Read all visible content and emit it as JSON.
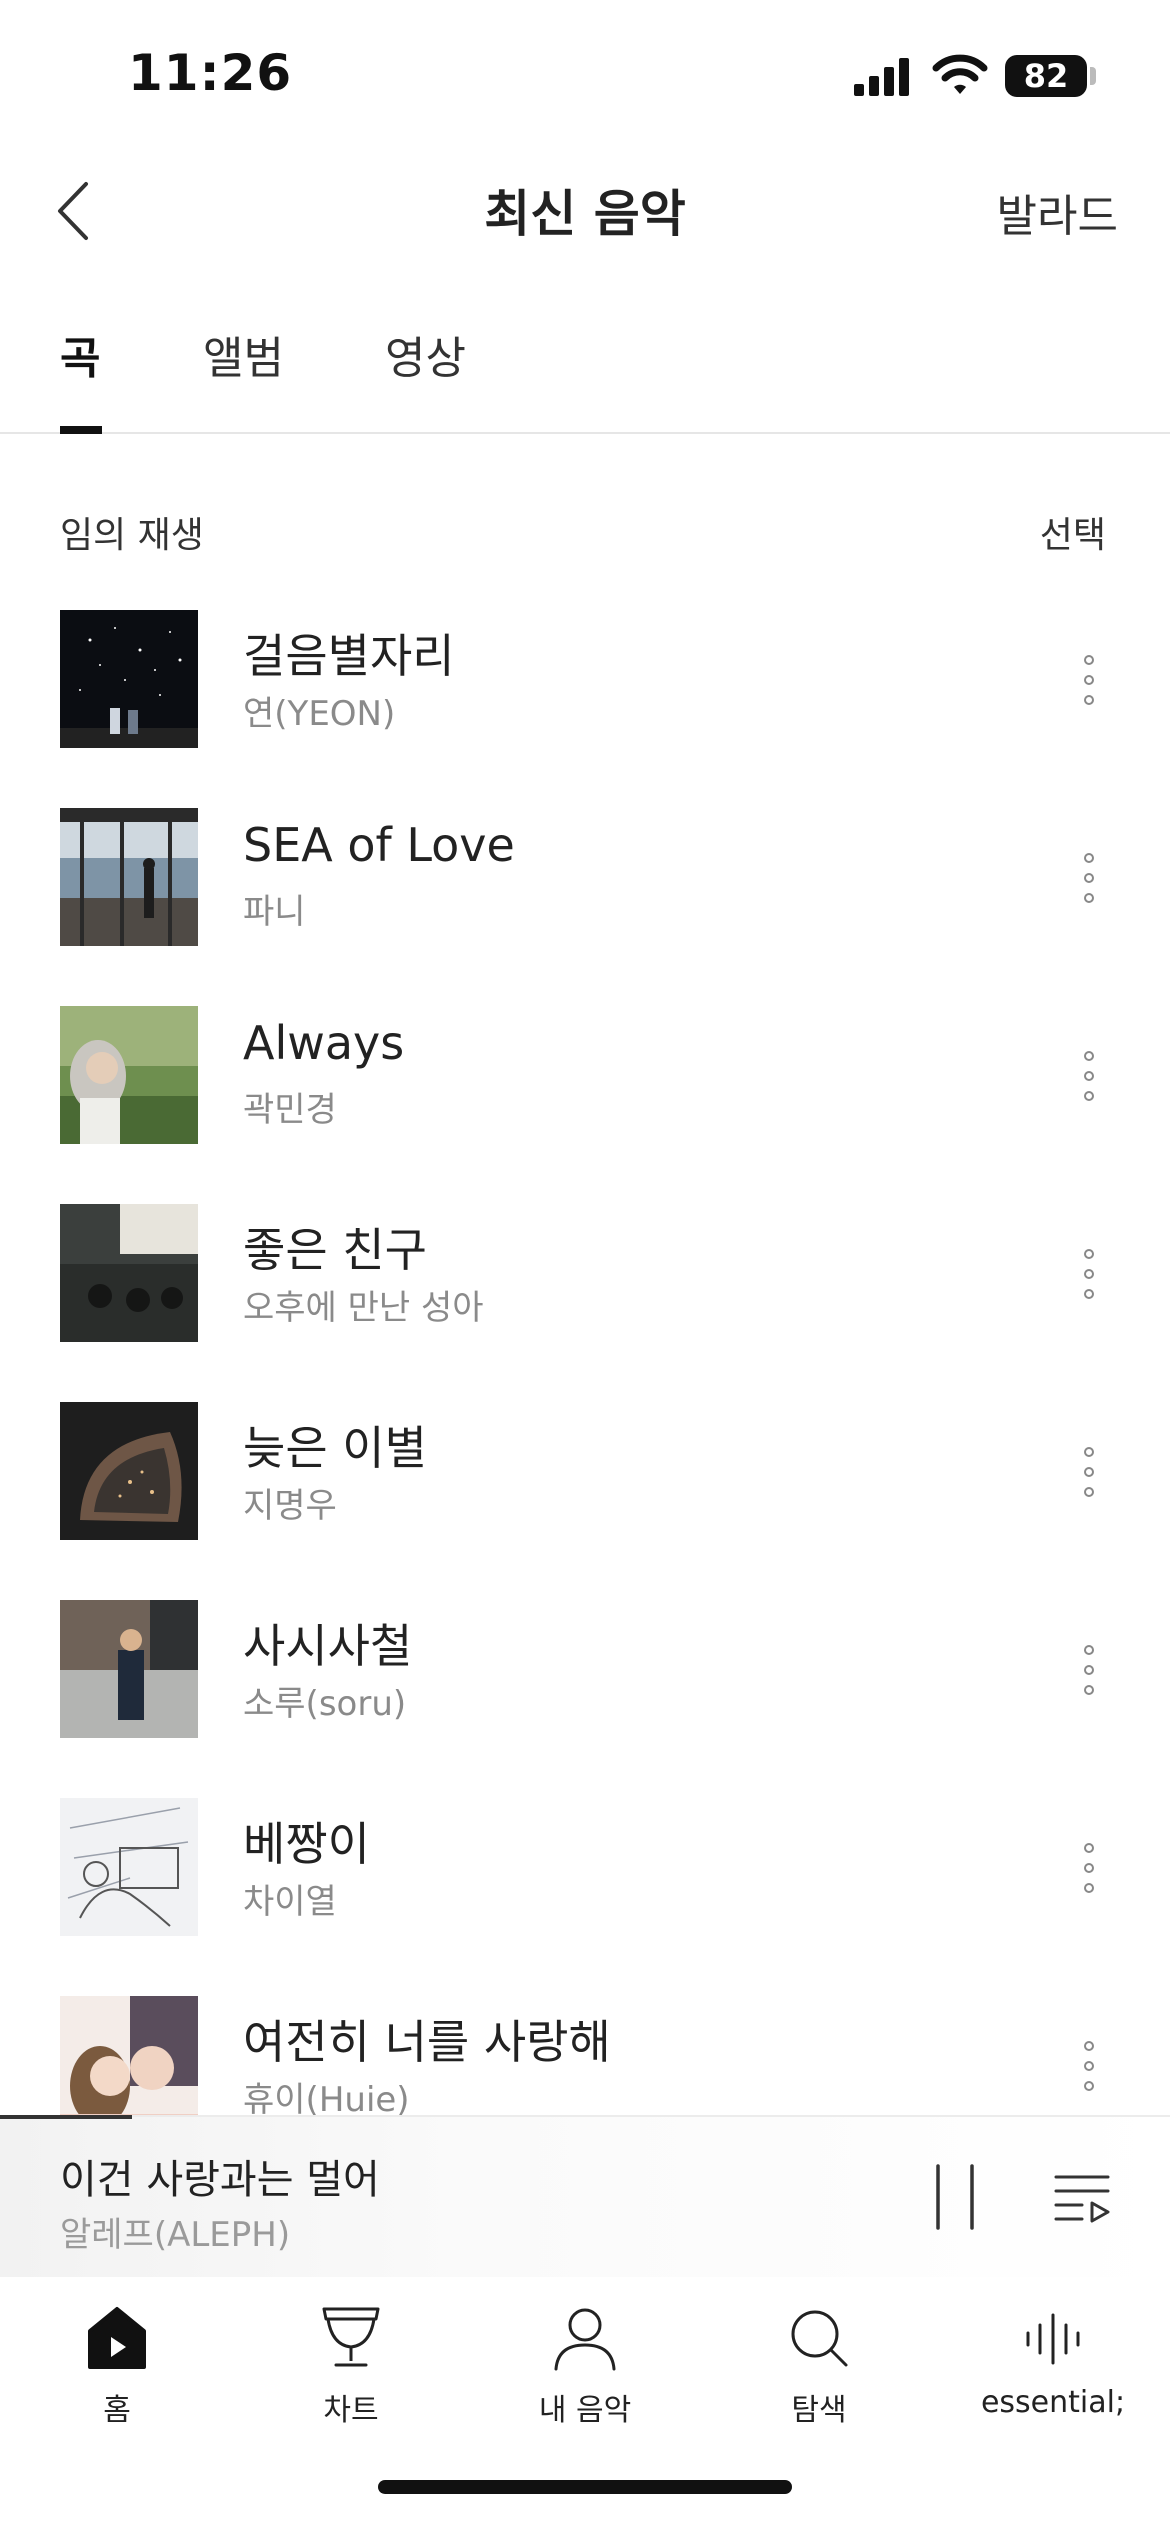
{
  "status_bar": {
    "time": "11:26",
    "battery": "82"
  },
  "nav": {
    "title": "최신 음악",
    "action": "발라드"
  },
  "tabs": [
    {
      "label": "곡",
      "active": true
    },
    {
      "label": "앨범",
      "active": false
    },
    {
      "label": "영상",
      "active": false
    }
  ],
  "list_header": {
    "shuffle_label": "임의 재생",
    "select_label": "선택"
  },
  "songs": [
    {
      "title": "걸음별자리",
      "artist": "연(YEON)"
    },
    {
      "title": "SEA of Love",
      "artist": "파니"
    },
    {
      "title": "Always",
      "artist": "곽민경"
    },
    {
      "title": "좋은 친구",
      "artist": "오후에 만난 성아"
    },
    {
      "title": "늦은 이별",
      "artist": "지명우"
    },
    {
      "title": "사시사철",
      "artist": "소루(soru)"
    },
    {
      "title": "베짱이",
      "artist": "차이열"
    },
    {
      "title": "여전히 너를 사랑해",
      "artist": "휴이(Huie)"
    }
  ],
  "now_playing": {
    "title": "이건 사랑과는 멀어",
    "artist": "알레프(ALEPH)"
  },
  "bottom_tabs": [
    {
      "label": "홈",
      "icon": "home-icon",
      "active": true
    },
    {
      "label": "차트",
      "icon": "trophy-icon",
      "active": false
    },
    {
      "label": "내 음악",
      "icon": "person-icon",
      "active": false
    },
    {
      "label": "탐색",
      "icon": "search-icon",
      "active": false
    },
    {
      "label": "essential;",
      "icon": "soundwave-icon",
      "active": false
    }
  ]
}
